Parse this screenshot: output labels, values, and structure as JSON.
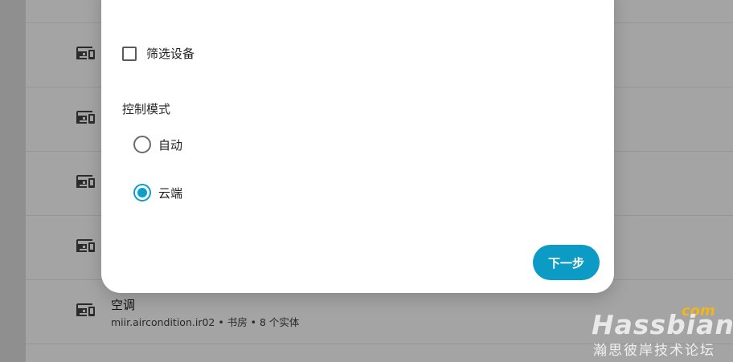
{
  "background_list": {
    "rows": [
      {
        "title": "",
        "subtitle": ""
      },
      {
        "title": "",
        "subtitle": ""
      },
      {
        "title": "",
        "subtitle": ""
      },
      {
        "title": "",
        "subtitle": ""
      },
      {
        "title": "",
        "subtitle": ""
      },
      {
        "title": "空调",
        "subtitle": "miir.aircondition.ir02 • 书房 • 8 个实体"
      }
    ]
  },
  "dialog": {
    "filter_devices_label": "筛选设备",
    "filter_devices_checked": false,
    "control_mode_label": "控制模式",
    "control_mode_options": [
      {
        "label": "自动",
        "checked": false
      },
      {
        "label": "云端",
        "checked": true
      }
    ],
    "next_button_label": "下一步"
  },
  "colors": {
    "accent": "#0b9bc4",
    "overlay": "#8f8f8f"
  },
  "watermark": {
    "com": "com",
    "main": "Hassbian",
    "sub": "瀚思彼岸技术论坛"
  }
}
